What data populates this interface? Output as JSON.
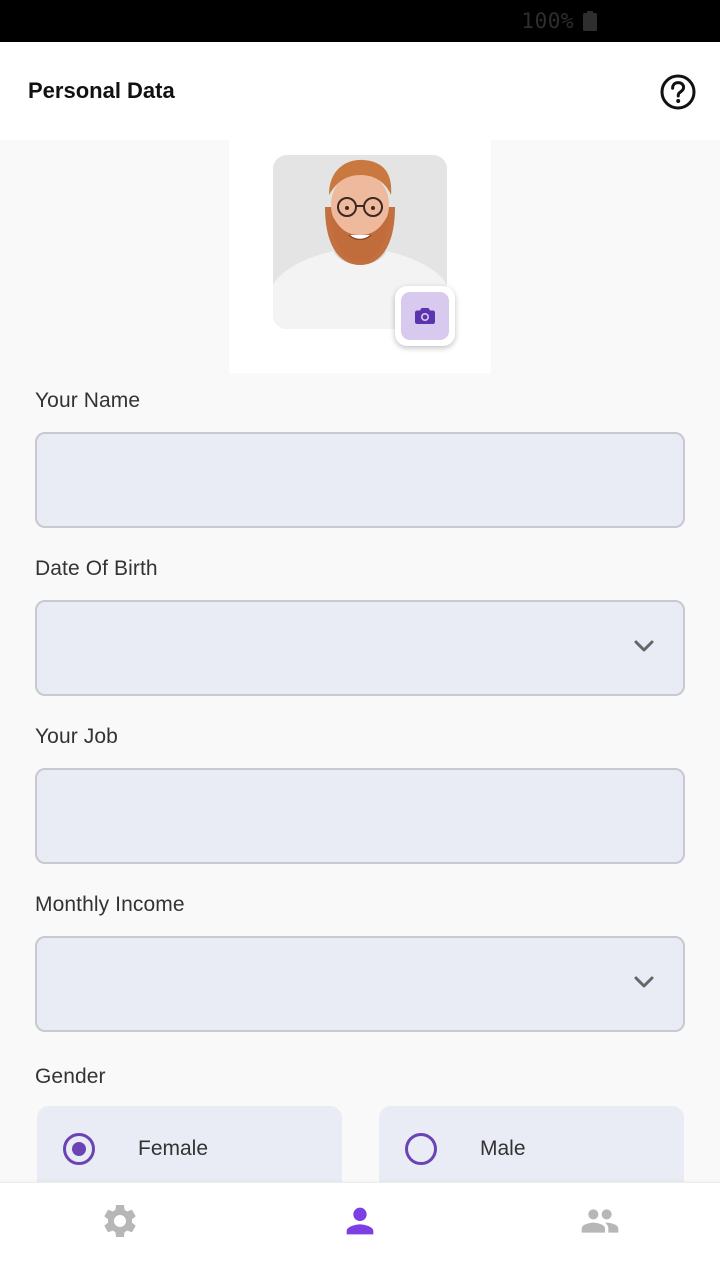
{
  "status_bar": {
    "battery_text": "100%"
  },
  "app_bar": {
    "title": "Personal Data"
  },
  "profile": {
    "photo_alt": "profile photo"
  },
  "fields": {
    "name_label": "Your Name",
    "name_value": "",
    "dob_label": "Date Of Birth",
    "dob_value": "",
    "job_label": "Your Job",
    "job_value": "",
    "income_label": "Monthly Income",
    "income_value": ""
  },
  "gender": {
    "label": "Gender",
    "options": [
      {
        "label": "Female",
        "selected": true
      },
      {
        "label": "Male",
        "selected": false
      }
    ]
  },
  "colors": {
    "accent": "#6a44b5",
    "accent_light": "#d8c9ee",
    "field_bg": "#e9ebf5",
    "nav_active": "#7b3fe4",
    "nav_inactive": "#b7b7b7"
  },
  "bottom_nav": {
    "items": [
      {
        "icon": "gear-icon",
        "active": false
      },
      {
        "icon": "person-icon",
        "active": true
      },
      {
        "icon": "group-icon",
        "active": false
      }
    ]
  }
}
